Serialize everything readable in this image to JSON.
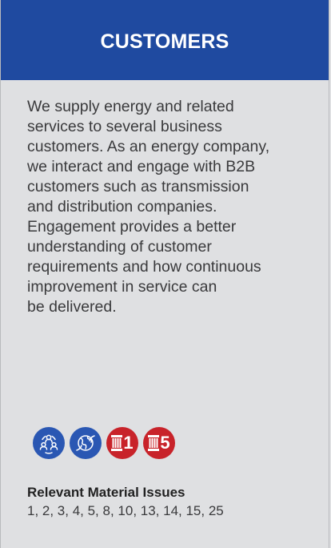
{
  "card": {
    "title": "CUSTOMERS",
    "description": "We supply energy and related\nservices to several business\ncustomers. As an energy company,\nwe interact and engage with B2B\ncustomers such as transmission\nand distribution companies.\nEngagement provides a better\nunderstanding of customer\nrequirements and how continuous\nimprovement in service can\nbe delivered.",
    "icons": [
      {
        "name": "stakeholders-icon",
        "color": "#2a57b3"
      },
      {
        "name": "globe-leaf-icon",
        "color": "#2a57b3"
      },
      {
        "name": "pillar-1-icon",
        "color": "#c8232a",
        "number": "1"
      },
      {
        "name": "pillar-5-icon",
        "color": "#c8232a",
        "number": "5"
      }
    ],
    "relevant_title": "Relevant Material Issues",
    "relevant_list": "1, 2, 3, 4, 5, 8, 10, 13, 14, 15, 25"
  },
  "colors": {
    "header_bg": "#1f4aa0",
    "card_bg": "#dfe0e2",
    "icon_blue": "#2a57b3",
    "icon_red": "#c8232a"
  }
}
